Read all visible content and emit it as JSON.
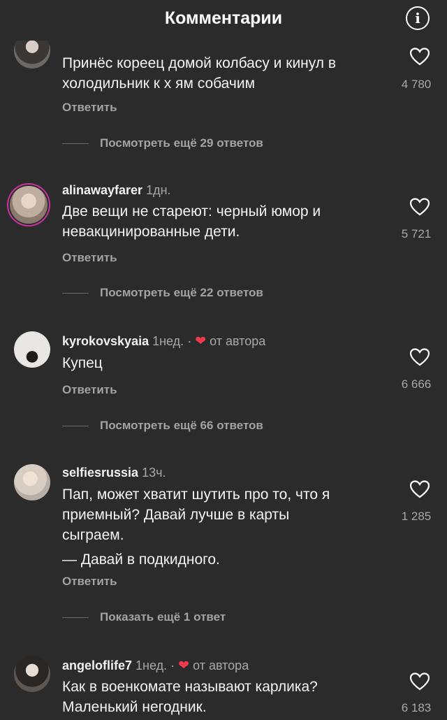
{
  "header": {
    "title": "Комментарии",
    "info_icon": "info-icon"
  },
  "comments": [
    {
      "user": "",
      "time": "",
      "lines": [
        "Принёс кореец домой колбасу и кинул в",
        "холодильник к х ям собачим"
      ],
      "reply_label": "Ответить",
      "likes": "4 780",
      "view_more": "Посмотреть ещё 29 ответов"
    },
    {
      "user": "alinawayfarer",
      "time": "1дн.",
      "lines": [
        "Две вещи не стареют: черный юмор и",
        "невакцинированные дети."
      ],
      "reply_label": "Ответить",
      "likes": "5 721",
      "view_more": "Посмотреть ещё 22 ответов"
    },
    {
      "user": "kyrokovskyaia",
      "time": "1нед.",
      "dot": "·",
      "author_label": "от автора",
      "lines": [
        "Купец"
      ],
      "reply_label": "Ответить",
      "likes": "6 666",
      "view_more": "Посмотреть ещё 66 ответов"
    },
    {
      "user": "selfiesrussia",
      "time": "13ч.",
      "lines": [
        "Пап, может хватит шутить про то, что я",
        "приемный? Давай лучше в карты",
        "сыграем.",
        "— Давай в подкидного."
      ],
      "reply_label": "Ответить",
      "likes": "1 285",
      "view_more": "Показать ещё 1 ответ"
    },
    {
      "user": "angeloflife7",
      "time": "1нед.",
      "dot": "·",
      "author_label": "от автора",
      "lines": [
        "Как в военкомате называют карлика?",
        "Маленький негодник."
      ],
      "likes": "6 183"
    }
  ],
  "colors": {
    "background": "#2b2b2b",
    "heart_red": "#f23a4f",
    "secondary_text": "#a8a8a8"
  }
}
